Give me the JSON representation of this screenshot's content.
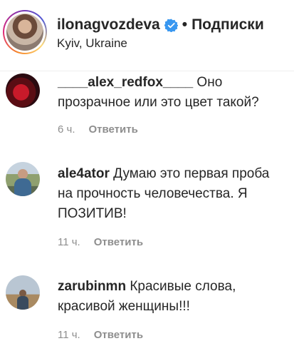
{
  "header": {
    "username": "ilonagvozdeva",
    "separator": "•",
    "follow_label": "Подписки",
    "location": "Kyiv, Ukraine",
    "verified_icon": "verified-badge-icon",
    "accent_color": "#3897f0"
  },
  "comments": [
    {
      "username": "____alex_redfox____",
      "text": " Оно прозрачное или это цвет такой?",
      "time": "6 ч.",
      "reply_label": "Ответить"
    },
    {
      "username": "ale4ator",
      "text": " Думаю это первая проба на прочность человечества. Я ПОЗИТИВ!",
      "time": "11 ч.",
      "reply_label": "Ответить"
    },
    {
      "username": "zarubinmn",
      "text": " Красивые слова, красивой женщины!!!",
      "time": "11 ч.",
      "reply_label": "Ответить"
    }
  ]
}
